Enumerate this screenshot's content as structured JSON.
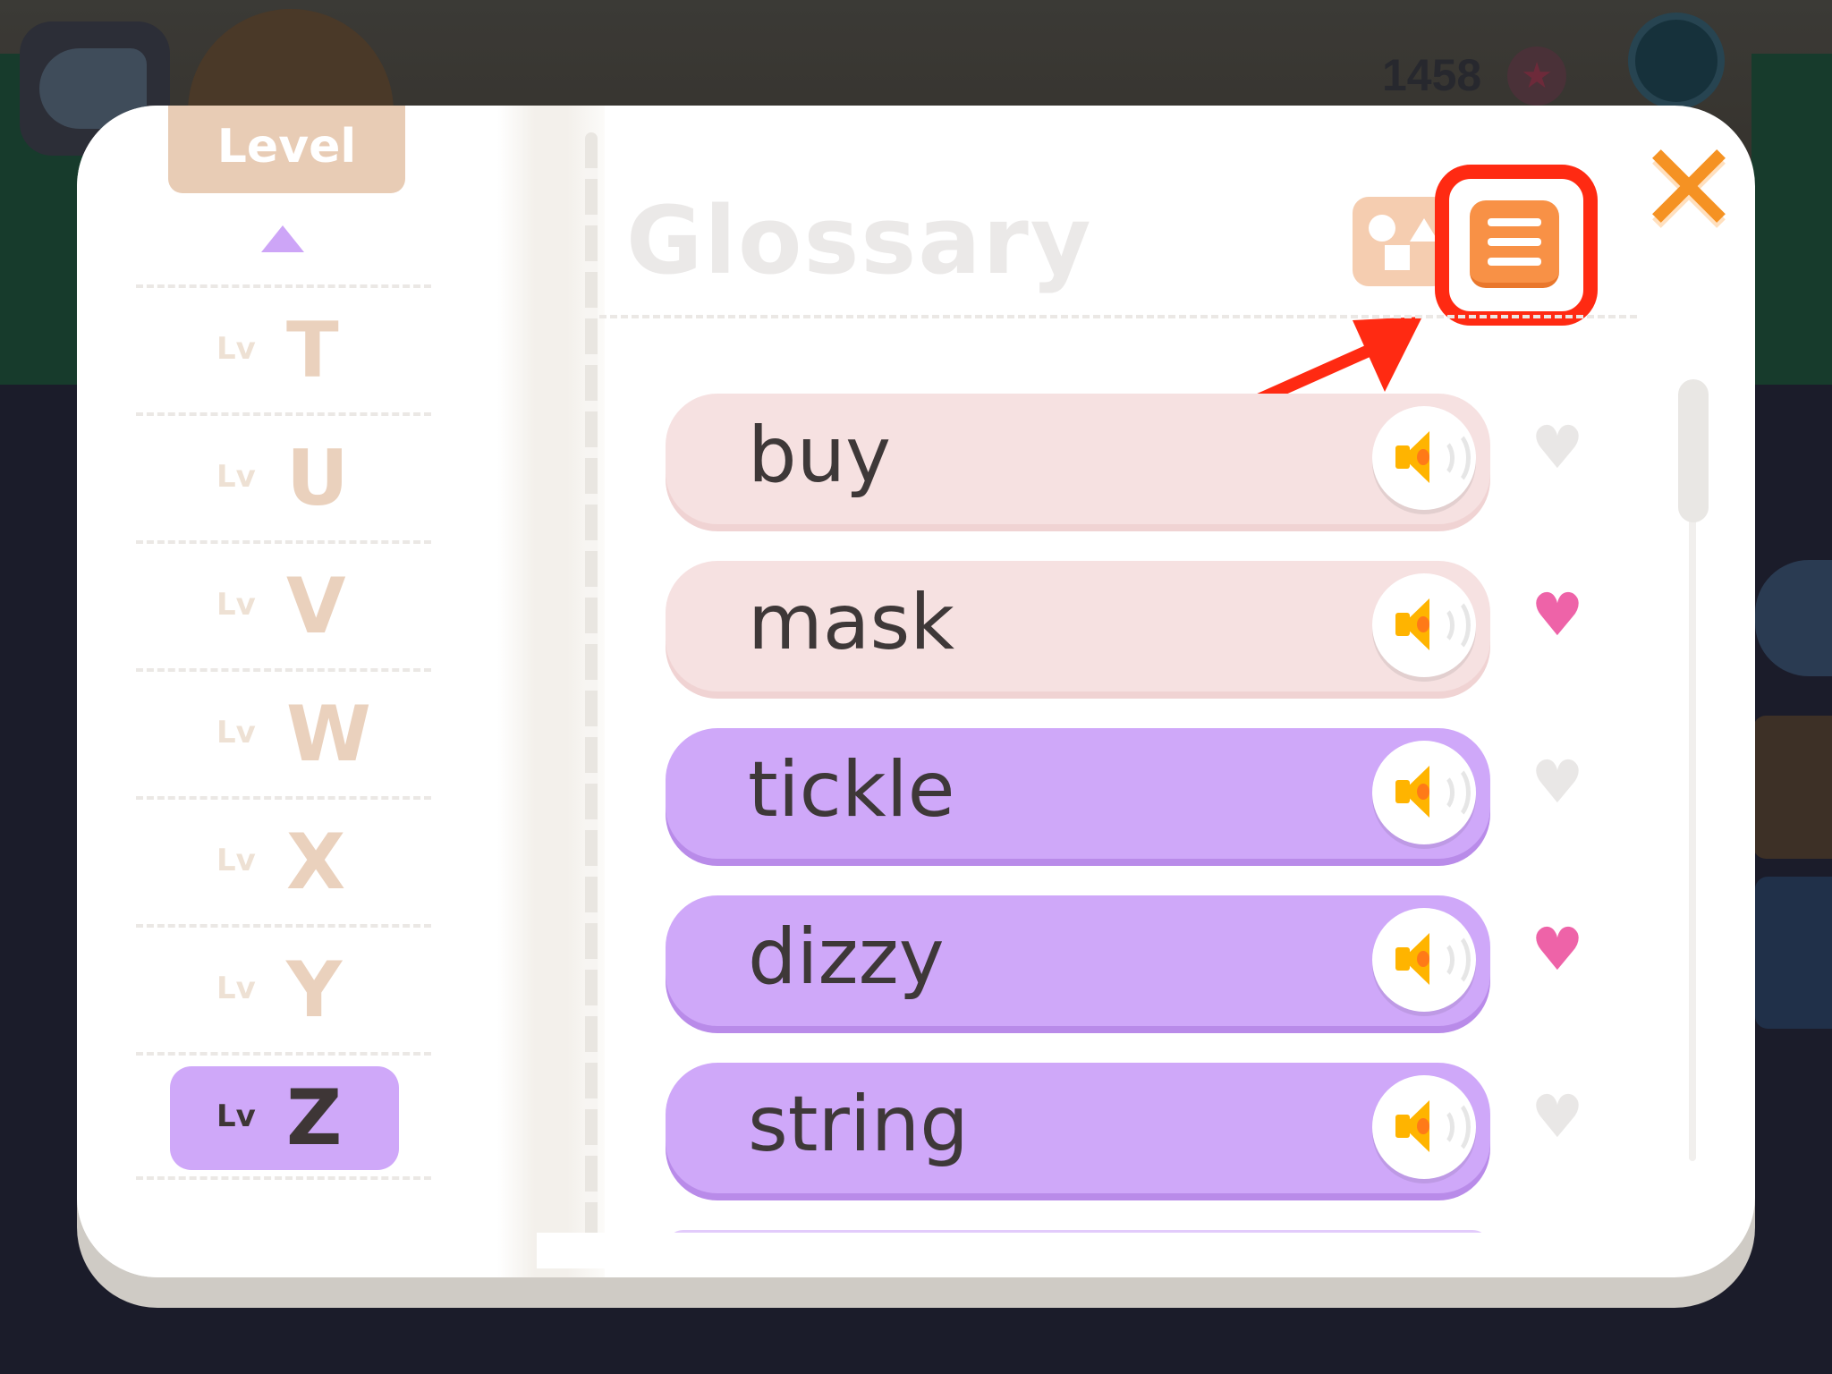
{
  "background": {
    "score": "1458"
  },
  "sidebar": {
    "header": "Level",
    "prefix": "Lv",
    "levels": [
      {
        "letter": "T",
        "selected": false
      },
      {
        "letter": "U",
        "selected": false
      },
      {
        "letter": "V",
        "selected": false
      },
      {
        "letter": "W",
        "selected": false
      },
      {
        "letter": "X",
        "selected": false
      },
      {
        "letter": "Y",
        "selected": false
      },
      {
        "letter": "Z",
        "selected": true
      }
    ]
  },
  "main": {
    "title": "Glossary",
    "close_symbol": "✕",
    "view_modes": [
      "shapes-view",
      "list-view"
    ],
    "active_view": "list-view"
  },
  "words": [
    {
      "text": "buy",
      "style": "pink",
      "favorite": false
    },
    {
      "text": "mask",
      "style": "pink",
      "favorite": true
    },
    {
      "text": "tickle",
      "style": "purple",
      "favorite": false
    },
    {
      "text": "dizzy",
      "style": "purple",
      "favorite": true
    },
    {
      "text": "string",
      "style": "purple",
      "favorite": false
    }
  ],
  "colors": {
    "accent_orange": "#f89146",
    "highlight_red": "#ff2a12",
    "purple_pill": "#cfa8f9",
    "pink_pill": "#f6e1e1",
    "heart_on": "#ee63a8",
    "heart_off": "#e9e7e6"
  },
  "icons": {
    "heart": "♥",
    "star": "★"
  }
}
